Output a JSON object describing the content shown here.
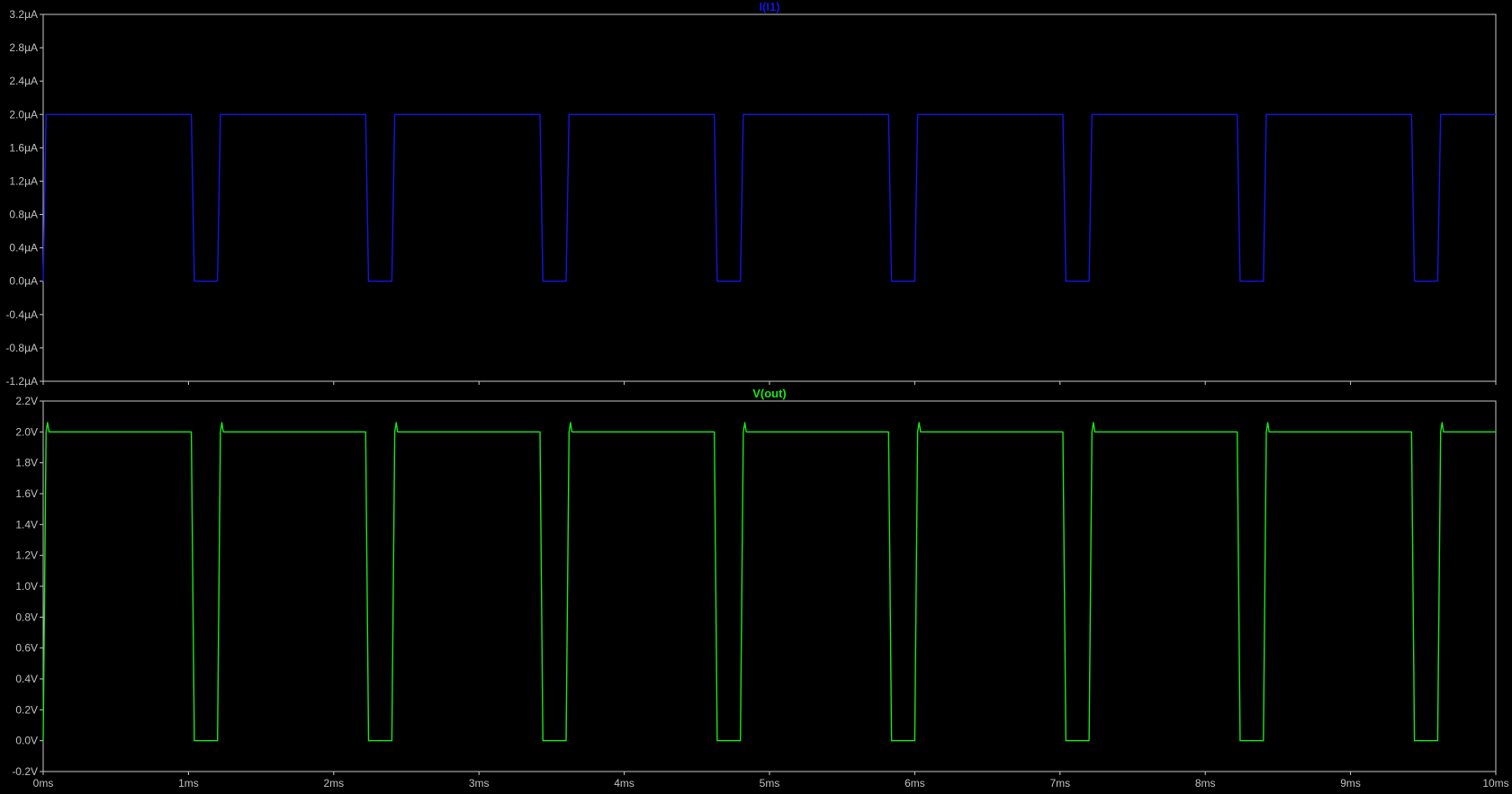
{
  "colors": {
    "background": "#000000",
    "frame": "#c8c8c8",
    "tick_text": "#c0c0c0",
    "current_trace": "#1414e6",
    "voltage_trace": "#19e619"
  },
  "x_axis": {
    "min": 0,
    "max": 10,
    "ticks": [
      0,
      1,
      2,
      3,
      4,
      5,
      6,
      7,
      8,
      9,
      10
    ],
    "tick_labels": [
      "0ms",
      "1ms",
      "2ms",
      "3ms",
      "4ms",
      "5ms",
      "6ms",
      "7ms",
      "8ms",
      "9ms",
      "10ms"
    ]
  },
  "chart_data": [
    {
      "type": "line",
      "title": "I(I1)",
      "color": "#1414e6",
      "ylim": [
        -1.2,
        3.2
      ],
      "yticks": [
        -1.2,
        -0.8,
        -0.4,
        0.0,
        0.4,
        0.8,
        1.2,
        1.6,
        2.0,
        2.4,
        2.8,
        3.2
      ],
      "ytick_labels": [
        "-1.2µA",
        "-0.8µA",
        "-0.4µA",
        "0.0µA",
        "0.4µA",
        "0.8µA",
        "1.2µA",
        "1.6µA",
        "2.0µA",
        "2.4µA",
        "2.8µA",
        "3.2µA"
      ],
      "x": [
        0,
        0.02,
        1.02,
        1.04,
        1.2,
        1.22,
        2.22,
        2.24,
        2.4,
        2.42,
        3.42,
        3.44,
        3.6,
        3.62,
        4.62,
        4.64,
        4.8,
        4.82,
        5.82,
        5.84,
        6.0,
        6.02,
        7.02,
        7.04,
        7.2,
        7.22,
        8.22,
        8.24,
        8.4,
        8.42,
        9.42,
        9.44,
        9.6,
        9.62,
        10.0
      ],
      "y": [
        0,
        2.0,
        2.0,
        0,
        0,
        2.0,
        2.0,
        0,
        0,
        2.0,
        2.0,
        0,
        0,
        2.0,
        2.0,
        0,
        0,
        2.0,
        2.0,
        0,
        0,
        2.0,
        2.0,
        0,
        0,
        2.0,
        2.0,
        0,
        0,
        2.0,
        2.0,
        0,
        0,
        2.0,
        2.0
      ]
    },
    {
      "type": "line",
      "title": "V(out)",
      "color": "#19e619",
      "ylim": [
        -0.2,
        2.2
      ],
      "yticks": [
        -0.2,
        0.0,
        0.2,
        0.4,
        0.6,
        0.8,
        1.0,
        1.2,
        1.4,
        1.6,
        1.8,
        2.0,
        2.2
      ],
      "ytick_labels": [
        "-0.2V",
        "0.0V",
        "0.2V",
        "0.4V",
        "0.6V",
        "0.8V",
        "1.0V",
        "1.2V",
        "1.4V",
        "1.6V",
        "1.8V",
        "2.0V",
        "2.2V"
      ],
      "x": [
        0,
        0.02,
        0.03,
        0.04,
        1.02,
        1.04,
        1.2,
        1.22,
        1.23,
        1.24,
        2.22,
        2.24,
        2.4,
        2.42,
        2.43,
        2.44,
        3.42,
        3.44,
        3.6,
        3.62,
        3.63,
        3.64,
        4.62,
        4.64,
        4.8,
        4.82,
        4.83,
        4.84,
        5.82,
        5.84,
        6.0,
        6.02,
        6.03,
        6.04,
        7.02,
        7.04,
        7.2,
        7.22,
        7.23,
        7.24,
        8.22,
        8.24,
        8.4,
        8.42,
        8.43,
        8.44,
        9.42,
        9.44,
        9.6,
        9.62,
        9.63,
        9.64,
        10.0
      ],
      "y": [
        0,
        2.0,
        2.06,
        2.0,
        2.0,
        0,
        0,
        2.0,
        2.06,
        2.0,
        2.0,
        0,
        0,
        2.0,
        2.06,
        2.0,
        2.0,
        0,
        0,
        2.0,
        2.06,
        2.0,
        2.0,
        0,
        0,
        2.0,
        2.06,
        2.0,
        2.0,
        0,
        0,
        2.0,
        2.06,
        2.0,
        2.0,
        0,
        0,
        2.0,
        2.06,
        2.0,
        2.0,
        0,
        0,
        2.0,
        2.06,
        2.0,
        2.0,
        0,
        0,
        2.0,
        2.06,
        2.0,
        2.0
      ]
    }
  ]
}
